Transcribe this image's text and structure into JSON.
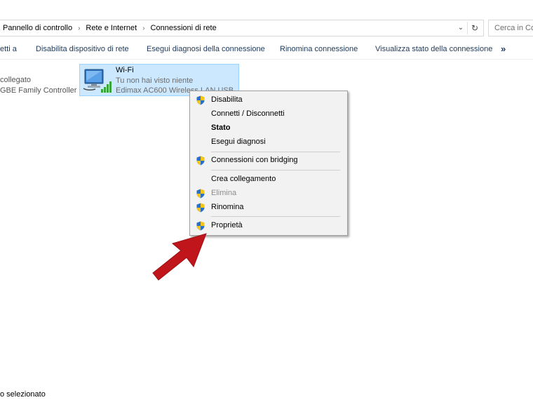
{
  "breadcrumb": [
    "Pannello di controllo",
    "Rete e Internet",
    "Connessioni di rete"
  ],
  "search": {
    "placeholder": "Cerca in Co"
  },
  "toolbar": {
    "items": [
      "etti a",
      "Disabilita dispositivo di rete",
      "Esegui diagnosi della connessione",
      "Rinomina connessione",
      "Visualizza stato della connessione"
    ],
    "more_label": "»"
  },
  "connections": {
    "left_item": {
      "status": "collegato",
      "adapter": "GBE Family Controller"
    },
    "wifi": {
      "name": "Wi-Fi",
      "status": "Tu non hai visto niente",
      "adapter": "Edimax AC600 Wireless LAN USB"
    }
  },
  "context_menu": {
    "items": [
      {
        "label": "Disabilita",
        "shield": true,
        "disabled": false,
        "bold": false
      },
      {
        "label": "Connetti / Disconnetti",
        "shield": false,
        "disabled": false,
        "bold": false
      },
      {
        "label": "Stato",
        "shield": false,
        "disabled": false,
        "bold": true
      },
      {
        "label": "Esegui diagnosi",
        "shield": false,
        "disabled": false,
        "bold": false
      },
      {
        "label": "Connessioni con bridging",
        "shield": true,
        "disabled": false,
        "bold": false
      },
      {
        "label": "Crea collegamento",
        "shield": false,
        "disabled": false,
        "bold": false
      },
      {
        "label": "Elimina",
        "shield": true,
        "disabled": true,
        "bold": false
      },
      {
        "label": "Rinomina",
        "shield": true,
        "disabled": false,
        "bold": false
      },
      {
        "label": "Proprietà",
        "shield": true,
        "disabled": false,
        "bold": false
      }
    ]
  },
  "statusbar": {
    "text": "o selezionato"
  },
  "colors": {
    "selection": "#cce8ff",
    "arrow": "#c0161b",
    "shield_blue": "#2a6fc9",
    "shield_yellow": "#f5c518"
  }
}
